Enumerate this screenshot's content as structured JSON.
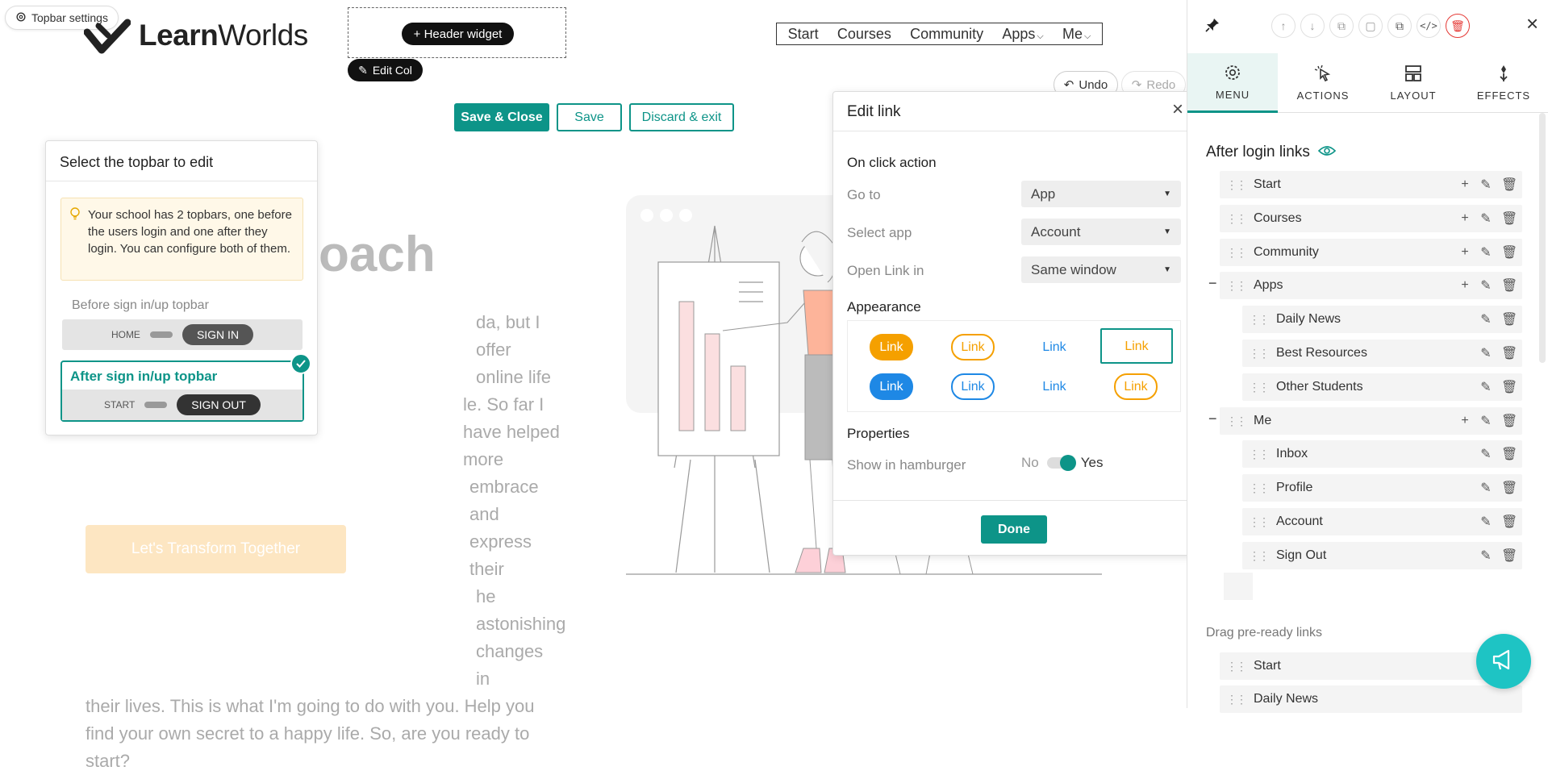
{
  "chip": {
    "label": "Topbar settings"
  },
  "logo": {
    "text_bold": "Learn",
    "text_light": "Worlds"
  },
  "canvas": {
    "header_widget": "+ Header widget",
    "edit_col": "Edit Col",
    "undo": "Undo",
    "redo": "Redo",
    "save_close": "Save & Close",
    "save": "Save",
    "discard": "Discard & exit"
  },
  "nav": {
    "items": [
      "Start",
      "Courses",
      "Community",
      "Apps",
      "Me"
    ]
  },
  "hero": {
    "heading": "oach",
    "text_lines": [
      "da, but I offer online life",
      "le. So far I have helped more",
      "embrace and express their",
      "he astonishing changes in",
      "their lives. This is what I'm going to do with you. Help you",
      "find your own secret to a happy life. So, are you ready to",
      "start?"
    ],
    "cta": "Let's Transform Together"
  },
  "topbar_popover": {
    "title": "Select the topbar to edit",
    "info": "Your school has 2 topbars, one before the users login and one after they login. You can configure both of them.",
    "before_label": "Before sign in/up topbar",
    "before_home": "HOME",
    "before_pill": "SIGN IN",
    "after_label": "After sign in/up topbar",
    "after_start": "START",
    "after_pill": "SIGN OUT"
  },
  "modal": {
    "title": "Edit link",
    "on_click": "On click action",
    "go_to_label": "Go to",
    "go_to_value": "App",
    "select_app_label": "Select app",
    "select_app_value": "Account",
    "open_in_label": "Open Link in",
    "open_in_value": "Same window",
    "appearance": "Appearance",
    "link_text": "Link",
    "properties": "Properties",
    "hamburger_label": "Show in hamburger",
    "no": "No",
    "yes": "Yes",
    "done": "Done"
  },
  "panel": {
    "tabs": [
      "MENU",
      "ACTIONS",
      "LAYOUT",
      "EFFECTS"
    ],
    "heading": "After login links",
    "links": [
      {
        "label": "Start",
        "level": 0,
        "add": true
      },
      {
        "label": "Courses",
        "level": 0,
        "add": true
      },
      {
        "label": "Community",
        "level": 0,
        "add": true
      },
      {
        "label": "Apps",
        "level": 0,
        "add": true,
        "collapsible": true
      },
      {
        "label": "Daily News",
        "level": 1,
        "add": false
      },
      {
        "label": "Best Resources",
        "level": 1,
        "add": false
      },
      {
        "label": "Other Students",
        "level": 1,
        "add": false
      },
      {
        "label": "Me",
        "level": 0,
        "add": true,
        "collapsible": true
      },
      {
        "label": "Inbox",
        "level": 1,
        "add": false
      },
      {
        "label": "Profile",
        "level": 1,
        "add": false
      },
      {
        "label": "Account",
        "level": 1,
        "add": false
      },
      {
        "label": "Sign Out",
        "level": 1,
        "add": false
      }
    ],
    "drag_title": "Drag pre-ready links",
    "ready_links": [
      "Start",
      "Daily News"
    ]
  },
  "colors": {
    "accent": "#0d9488",
    "orange": "#f5a000",
    "blue": "#1e88e5",
    "delete": "#e53935"
  }
}
